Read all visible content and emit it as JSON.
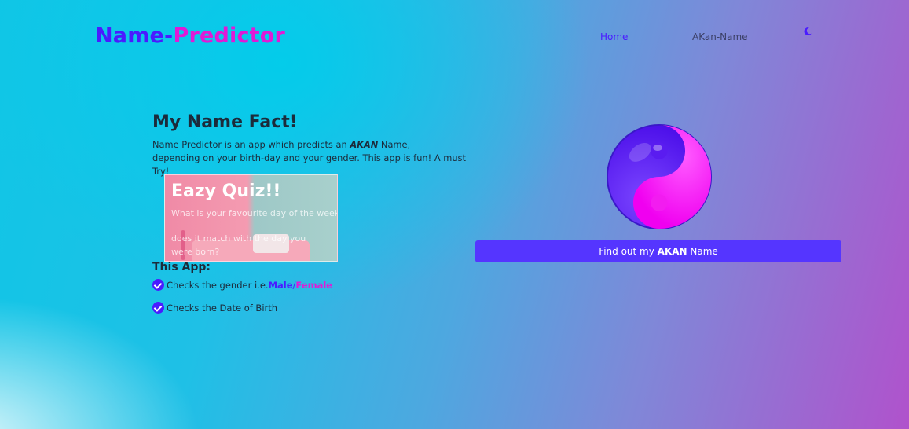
{
  "header": {
    "brand_part1": "Name-",
    "brand_part2": "Predictor",
    "nav": {
      "home": "Home",
      "akan_name": "AKan-Name"
    },
    "theme_icon": "moon-icon"
  },
  "hero": {
    "title": "My Name Fact!",
    "desc_before": "Name Predictor is an app which predicts an ",
    "desc_emphasis": "AKAN",
    "desc_line1_end": " Name,",
    "desc_line2": "depending on your birth-day and your gender. This app is fun! A must Try!"
  },
  "quiz": {
    "title": "Eazy Quiz!!",
    "question1": "What is your favourite day of the week?",
    "question2": "does it match with the day you were born?"
  },
  "features": {
    "heading": "This App:",
    "item1_prefix": "Checks the gender i.e. ",
    "male": "Male",
    "slash": " / ",
    "female": "Female",
    "item2": "Checks the Date of Birth",
    "check_icon": "check-circle-icon"
  },
  "cta": {
    "before": "Find out my ",
    "bold": "AKAN",
    "after": " Name"
  },
  "colors": {
    "primary": "#4a1bff",
    "magenta": "#e01ad6",
    "button": "#5535ff"
  },
  "illustration": "yin-yang-icon"
}
